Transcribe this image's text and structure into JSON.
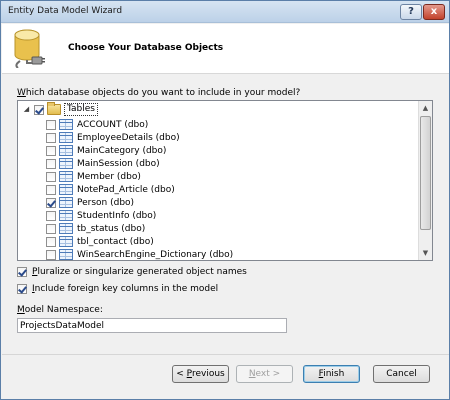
{
  "window": {
    "title": "Entity Data Model Wizard",
    "help_glyph": "?",
    "close_glyph": "x"
  },
  "header": {
    "title": "Choose Your Database Objects",
    "icon": "database-plug-icon"
  },
  "question": "Which database objects do you want to include in your model?",
  "tree": {
    "root": {
      "label": "Tables",
      "state": "partial",
      "expander": "◢"
    },
    "items": [
      {
        "label": "ACCOUNT (dbo)",
        "checked": false
      },
      {
        "label": "EmployeeDetails (dbo)",
        "checked": false
      },
      {
        "label": "MainCategory (dbo)",
        "checked": false
      },
      {
        "label": "MainSession (dbo)",
        "checked": false
      },
      {
        "label": "Member (dbo)",
        "checked": false
      },
      {
        "label": "NotePad_Article (dbo)",
        "checked": false
      },
      {
        "label": "Person (dbo)",
        "checked": true
      },
      {
        "label": "StudentInfo (dbo)",
        "checked": false
      },
      {
        "label": "tb_status (dbo)",
        "checked": false
      },
      {
        "label": "tbl_contact (dbo)",
        "checked": false
      },
      {
        "label": "WinSearchEngine_Dictionary (dbo)",
        "checked": false
      }
    ]
  },
  "options": {
    "pluralize": {
      "label": "Pluralize or singularize generated object names",
      "checked": true
    },
    "foreign_keys": {
      "label": "Include foreign key columns in the model",
      "checked": true
    }
  },
  "namespace": {
    "label": "Model Namespace:",
    "value": "ProjectsDataModel"
  },
  "buttons": {
    "previous": "< Previous",
    "next": "Next >",
    "finish": "Finish",
    "cancel": "Cancel"
  },
  "colors": {
    "title_bar": "#bcd1e8",
    "close": "#c2422b",
    "accent": "#3c7fb1"
  }
}
